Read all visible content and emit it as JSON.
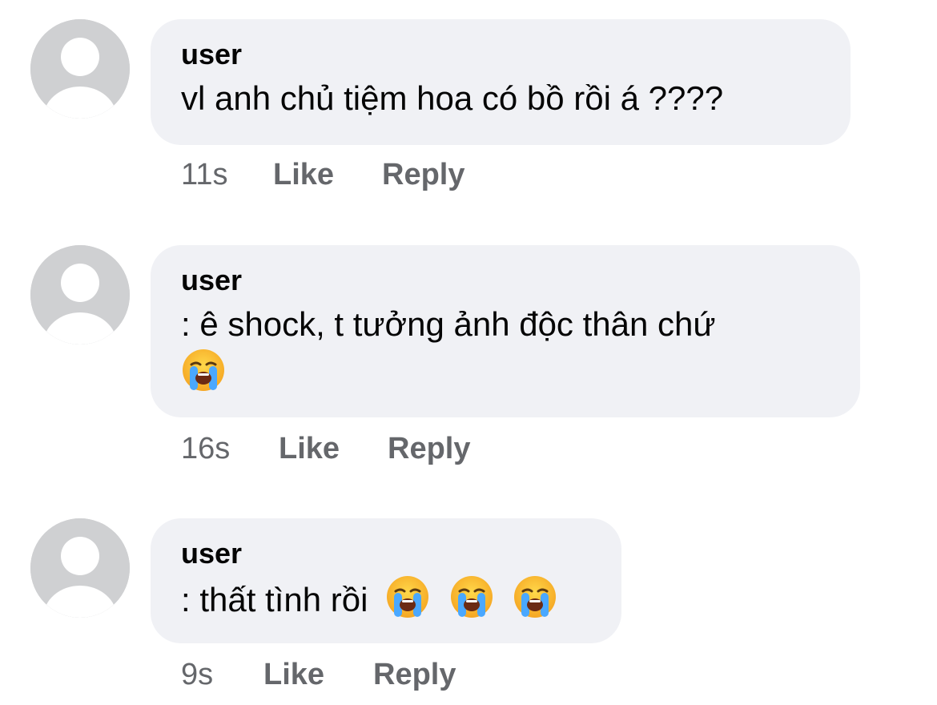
{
  "comments": [
    {
      "author": "user",
      "text": "vl anh chủ tiệm hoa có bồ rồi á ????",
      "time": "11s",
      "like_label": "Like",
      "reply_label": "Reply"
    },
    {
      "author": "user",
      "text": ": ê shock, t tưởng ảnh độc thân chứ",
      "emoji": "loudly-crying-face-icon",
      "time": "16s",
      "like_label": "Like",
      "reply_label": "Reply"
    },
    {
      "author": "user",
      "text": ": thất tình rồi",
      "emoji": "loudly-crying-face-icon",
      "time": "9s",
      "like_label": "Like",
      "reply_label": "Reply"
    }
  ],
  "colors": {
    "bubble": "#f0f1f5",
    "avatar": "#cfd0d2",
    "meta_text": "#65676b",
    "text": "#050505"
  }
}
